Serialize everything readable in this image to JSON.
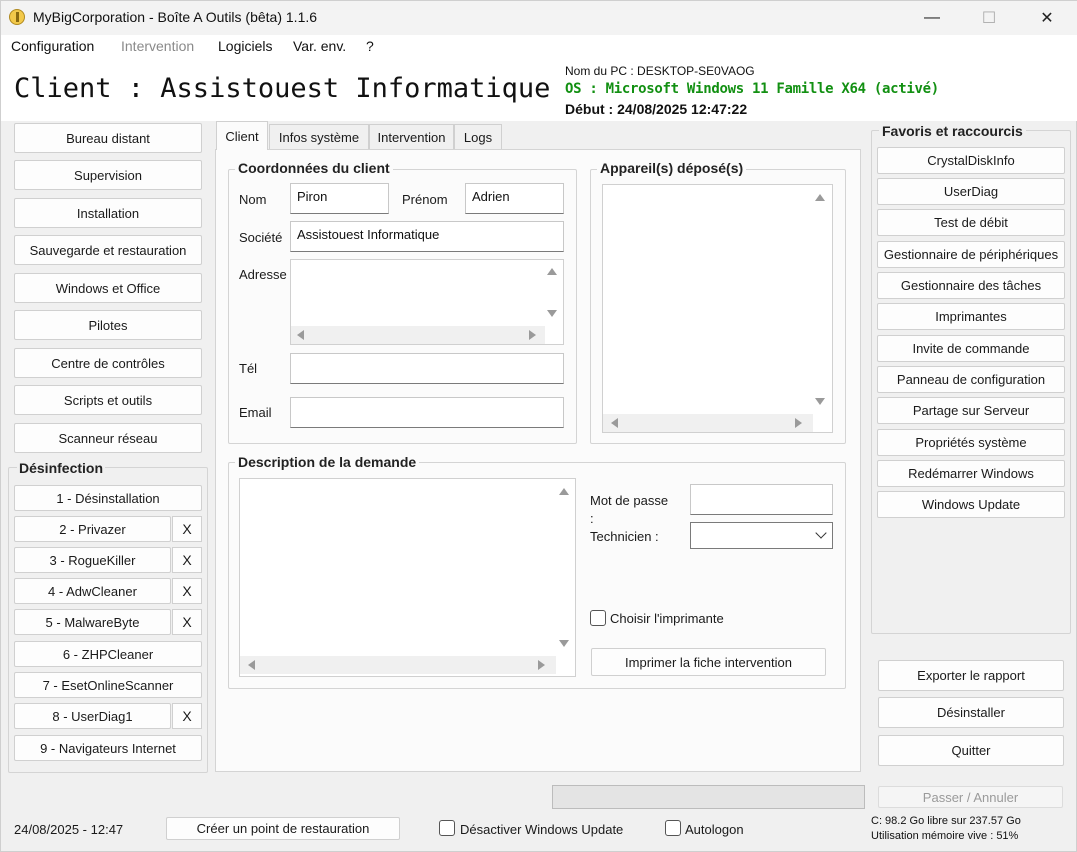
{
  "window": {
    "title": "MyBigCorporation - Boîte A Outils (bêta) 1.1.6",
    "minimize": "—",
    "maximize": "☐",
    "close": "✕"
  },
  "menu": {
    "configuration": "Configuration",
    "intervention": "Intervention",
    "logiciels": "Logiciels",
    "var_env": "Var. env.",
    "help": "?"
  },
  "header": {
    "client_title": "Client : Assistouest Informatique",
    "pc_name": "Nom du PC : DESKTOP-SE0VAOG",
    "os": "OS : Microsoft Windows 11 Famille X64  (activé)",
    "debut": "Début : 24/08/2025 12:47:22"
  },
  "left_nav": {
    "buttons": [
      "Bureau distant",
      "Supervision",
      "Installation",
      "Sauvegarde et restauration",
      "Windows et Office",
      "Pilotes",
      "Centre de contrôles",
      "Scripts et outils",
      "Scanneur réseau"
    ],
    "desinfection_title": "Désinfection",
    "desinfection_items": [
      {
        "label": "1 - Désinstallation",
        "x": ""
      },
      {
        "label": "2 - Privazer",
        "x": "X"
      },
      {
        "label": "3 - RogueKiller",
        "x": "X"
      },
      {
        "label": "4 - AdwCleaner",
        "x": "X"
      },
      {
        "label": "5 - MalwareByte",
        "x": "X"
      },
      {
        "label": "6 - ZHPCleaner",
        "x": ""
      },
      {
        "label": "7 - EsetOnlineScanner",
        "x": ""
      },
      {
        "label": "8 - UserDiag1",
        "x": "X"
      },
      {
        "label": "9 - Navigateurs Internet",
        "x": ""
      }
    ]
  },
  "tabs": [
    "Client",
    "Infos système",
    "Intervention",
    "Logs"
  ],
  "client_form": {
    "coordonnees_title": "Coordonnées du client",
    "nom_label": "Nom",
    "nom_value": "Piron",
    "prenom_label": "Prénom",
    "prenom_value": "Adrien",
    "societe_label": "Société",
    "societe_value": "Assistouest Informatique",
    "adresse_label": "Adresse",
    "tel_label": "Tél",
    "email_label": "Email",
    "appareils_title": "Appareil(s) déposé(s)",
    "description_title": "Description de la demande",
    "mot_de_passe_label": "Mot de passe :",
    "technicien_label": "Technicien :",
    "choisir_imprimante_label": "Choisir l'imprimante",
    "imprimer_button": "Imprimer la fiche intervention"
  },
  "favoris": {
    "title": "Favoris et raccourcis",
    "items": [
      "CrystalDiskInfo",
      "UserDiag",
      "Test de débit",
      "Gestionnaire de périphériques",
      "Gestionnaire des tâches",
      "Imprimantes",
      "Invite de commande",
      "Panneau de configuration",
      "Partage sur Serveur",
      "Propriétés système",
      "Redémarrer Windows",
      "Windows Update"
    ]
  },
  "actions": {
    "exporter": "Exporter le rapport",
    "desinstaller": "Désinstaller",
    "quitter": "Quitter",
    "passer_annuler": "Passer / Annuler"
  },
  "status_bar": {
    "datetime": "24/08/2025 - 12:47",
    "restore_point_button": "Créer un point de restauration",
    "disable_wu_label": "Désactiver Windows Update",
    "autologon_label": "Autologon",
    "disk_info": "C: 98.2 Go libre sur 237.57 Go",
    "memory_info": "Utilisation mémoire vive : 51%"
  }
}
